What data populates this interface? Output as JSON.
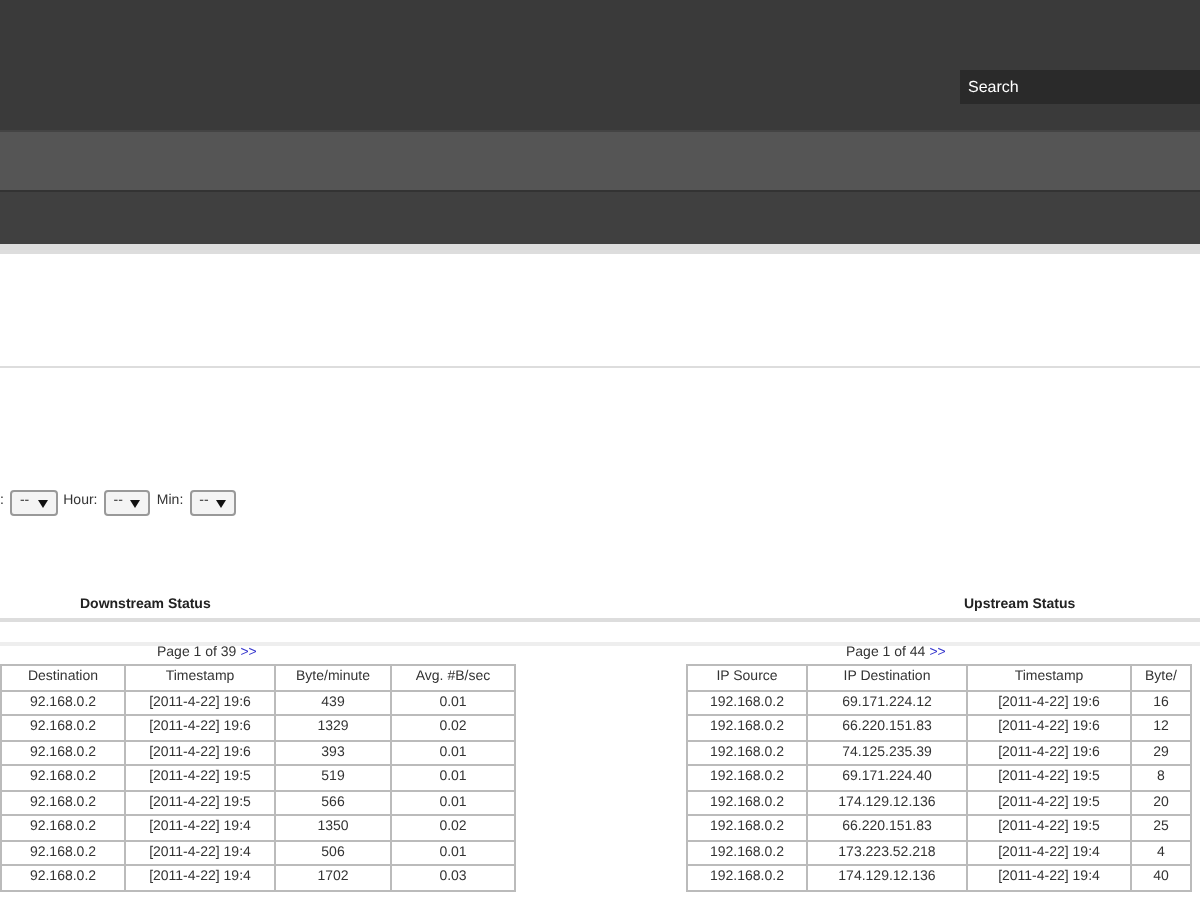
{
  "header": {
    "search": {
      "placeholder": "Search"
    }
  },
  "filters": [
    {
      "label": ":",
      "value": "--"
    },
    {
      "label": "Hour:",
      "value": "--"
    },
    {
      "label": "Min:",
      "value": "--"
    }
  ],
  "downstream": {
    "title": "Downstream Status",
    "pager": "Page 1 of 39",
    "next": ">>",
    "columns": [
      "Destination",
      "Timestamp",
      "Byte/minute",
      "Avg. #B/sec"
    ],
    "rows": [
      [
        "92.168.0.2",
        "[2011-4-22] 19:6",
        "439",
        "0.01"
      ],
      [
        "92.168.0.2",
        "[2011-4-22] 19:6",
        "1329",
        "0.02"
      ],
      [
        "92.168.0.2",
        "[2011-4-22] 19:6",
        "393",
        "0.01"
      ],
      [
        "92.168.0.2",
        "[2011-4-22] 19:5",
        "519",
        "0.01"
      ],
      [
        "92.168.0.2",
        "[2011-4-22] 19:5",
        "566",
        "0.01"
      ],
      [
        "92.168.0.2",
        "[2011-4-22] 19:4",
        "1350",
        "0.02"
      ],
      [
        "92.168.0.2",
        "[2011-4-22] 19:4",
        "506",
        "0.01"
      ],
      [
        "92.168.0.2",
        "[2011-4-22] 19:4",
        "1702",
        "0.03"
      ]
    ]
  },
  "upstream": {
    "title": "Upstream Status",
    "pager": "Page 1 of 44",
    "next": ">>",
    "columns": [
      "IP Source",
      "IP Destination",
      "Timestamp",
      "Byte/"
    ],
    "rows": [
      [
        "192.168.0.2",
        "69.171.224.12",
        "[2011-4-22] 19:6",
        "16"
      ],
      [
        "192.168.0.2",
        "66.220.151.83",
        "[2011-4-22] 19:6",
        "12"
      ],
      [
        "192.168.0.2",
        "74.125.235.39",
        "[2011-4-22] 19:6",
        "29"
      ],
      [
        "192.168.0.2",
        "69.171.224.40",
        "[2011-4-22] 19:5",
        "8"
      ],
      [
        "192.168.0.2",
        "174.129.12.136",
        "[2011-4-22] 19:5",
        "20"
      ],
      [
        "192.168.0.2",
        "66.220.151.83",
        "[2011-4-22] 19:5",
        "25"
      ],
      [
        "192.168.0.2",
        "173.223.52.218",
        "[2011-4-22] 19:4",
        "4"
      ],
      [
        "192.168.0.2",
        "174.129.12.136",
        "[2011-4-22] 19:4",
        "40"
      ]
    ]
  }
}
